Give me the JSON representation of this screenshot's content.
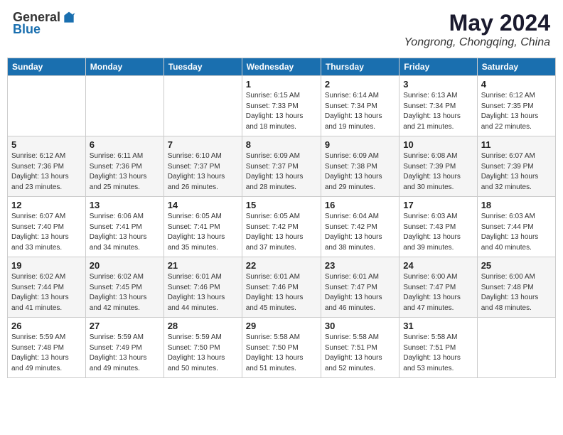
{
  "header": {
    "logo_general": "General",
    "logo_blue": "Blue",
    "month_year": "May 2024",
    "location": "Yongrong, Chongqing, China"
  },
  "weekdays": [
    "Sunday",
    "Monday",
    "Tuesday",
    "Wednesday",
    "Thursday",
    "Friday",
    "Saturday"
  ],
  "weeks": [
    [
      {
        "day": "",
        "info": ""
      },
      {
        "day": "",
        "info": ""
      },
      {
        "day": "",
        "info": ""
      },
      {
        "day": "1",
        "info": "Sunrise: 6:15 AM\nSunset: 7:33 PM\nDaylight: 13 hours\nand 18 minutes."
      },
      {
        "day": "2",
        "info": "Sunrise: 6:14 AM\nSunset: 7:34 PM\nDaylight: 13 hours\nand 19 minutes."
      },
      {
        "day": "3",
        "info": "Sunrise: 6:13 AM\nSunset: 7:34 PM\nDaylight: 13 hours\nand 21 minutes."
      },
      {
        "day": "4",
        "info": "Sunrise: 6:12 AM\nSunset: 7:35 PM\nDaylight: 13 hours\nand 22 minutes."
      }
    ],
    [
      {
        "day": "5",
        "info": "Sunrise: 6:12 AM\nSunset: 7:36 PM\nDaylight: 13 hours\nand 23 minutes."
      },
      {
        "day": "6",
        "info": "Sunrise: 6:11 AM\nSunset: 7:36 PM\nDaylight: 13 hours\nand 25 minutes."
      },
      {
        "day": "7",
        "info": "Sunrise: 6:10 AM\nSunset: 7:37 PM\nDaylight: 13 hours\nand 26 minutes."
      },
      {
        "day": "8",
        "info": "Sunrise: 6:09 AM\nSunset: 7:37 PM\nDaylight: 13 hours\nand 28 minutes."
      },
      {
        "day": "9",
        "info": "Sunrise: 6:09 AM\nSunset: 7:38 PM\nDaylight: 13 hours\nand 29 minutes."
      },
      {
        "day": "10",
        "info": "Sunrise: 6:08 AM\nSunset: 7:39 PM\nDaylight: 13 hours\nand 30 minutes."
      },
      {
        "day": "11",
        "info": "Sunrise: 6:07 AM\nSunset: 7:39 PM\nDaylight: 13 hours\nand 32 minutes."
      }
    ],
    [
      {
        "day": "12",
        "info": "Sunrise: 6:07 AM\nSunset: 7:40 PM\nDaylight: 13 hours\nand 33 minutes."
      },
      {
        "day": "13",
        "info": "Sunrise: 6:06 AM\nSunset: 7:41 PM\nDaylight: 13 hours\nand 34 minutes."
      },
      {
        "day": "14",
        "info": "Sunrise: 6:05 AM\nSunset: 7:41 PM\nDaylight: 13 hours\nand 35 minutes."
      },
      {
        "day": "15",
        "info": "Sunrise: 6:05 AM\nSunset: 7:42 PM\nDaylight: 13 hours\nand 37 minutes."
      },
      {
        "day": "16",
        "info": "Sunrise: 6:04 AM\nSunset: 7:42 PM\nDaylight: 13 hours\nand 38 minutes."
      },
      {
        "day": "17",
        "info": "Sunrise: 6:03 AM\nSunset: 7:43 PM\nDaylight: 13 hours\nand 39 minutes."
      },
      {
        "day": "18",
        "info": "Sunrise: 6:03 AM\nSunset: 7:44 PM\nDaylight: 13 hours\nand 40 minutes."
      }
    ],
    [
      {
        "day": "19",
        "info": "Sunrise: 6:02 AM\nSunset: 7:44 PM\nDaylight: 13 hours\nand 41 minutes."
      },
      {
        "day": "20",
        "info": "Sunrise: 6:02 AM\nSunset: 7:45 PM\nDaylight: 13 hours\nand 42 minutes."
      },
      {
        "day": "21",
        "info": "Sunrise: 6:01 AM\nSunset: 7:46 PM\nDaylight: 13 hours\nand 44 minutes."
      },
      {
        "day": "22",
        "info": "Sunrise: 6:01 AM\nSunset: 7:46 PM\nDaylight: 13 hours\nand 45 minutes."
      },
      {
        "day": "23",
        "info": "Sunrise: 6:01 AM\nSunset: 7:47 PM\nDaylight: 13 hours\nand 46 minutes."
      },
      {
        "day": "24",
        "info": "Sunrise: 6:00 AM\nSunset: 7:47 PM\nDaylight: 13 hours\nand 47 minutes."
      },
      {
        "day": "25",
        "info": "Sunrise: 6:00 AM\nSunset: 7:48 PM\nDaylight: 13 hours\nand 48 minutes."
      }
    ],
    [
      {
        "day": "26",
        "info": "Sunrise: 5:59 AM\nSunset: 7:48 PM\nDaylight: 13 hours\nand 49 minutes."
      },
      {
        "day": "27",
        "info": "Sunrise: 5:59 AM\nSunset: 7:49 PM\nDaylight: 13 hours\nand 49 minutes."
      },
      {
        "day": "28",
        "info": "Sunrise: 5:59 AM\nSunset: 7:50 PM\nDaylight: 13 hours\nand 50 minutes."
      },
      {
        "day": "29",
        "info": "Sunrise: 5:58 AM\nSunset: 7:50 PM\nDaylight: 13 hours\nand 51 minutes."
      },
      {
        "day": "30",
        "info": "Sunrise: 5:58 AM\nSunset: 7:51 PM\nDaylight: 13 hours\nand 52 minutes."
      },
      {
        "day": "31",
        "info": "Sunrise: 5:58 AM\nSunset: 7:51 PM\nDaylight: 13 hours\nand 53 minutes."
      },
      {
        "day": "",
        "info": ""
      }
    ]
  ]
}
